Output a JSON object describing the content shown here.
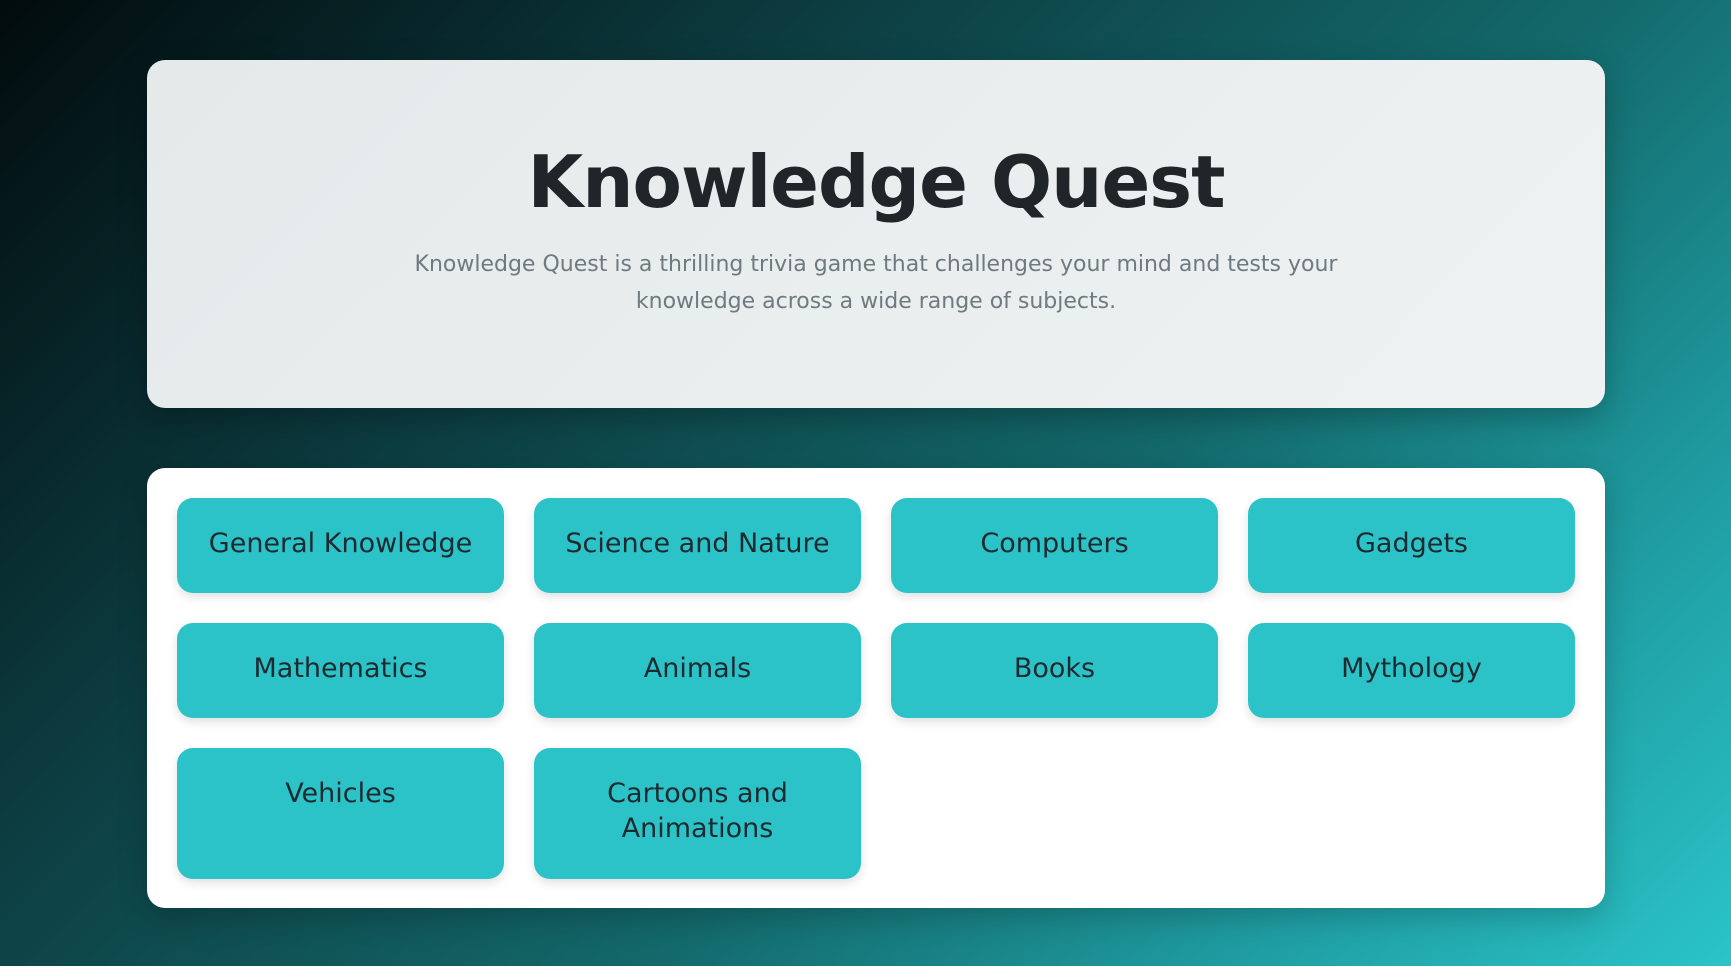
{
  "hero": {
    "title": "Knowledge Quest",
    "description": "Knowledge Quest is a thrilling trivia game that challenges your mind and tests your knowledge across a wide range of subjects."
  },
  "categories": [
    "General Knowledge",
    "Science and Nature",
    "Computers",
    "Gadgets",
    "Mathematics",
    "Animals",
    "Books",
    "Mythology",
    "Vehicles",
    "Cartoons and Animations"
  ],
  "colors": {
    "button": "#2bc3c8",
    "title": "#1f2528",
    "description": "#6f7a80"
  }
}
